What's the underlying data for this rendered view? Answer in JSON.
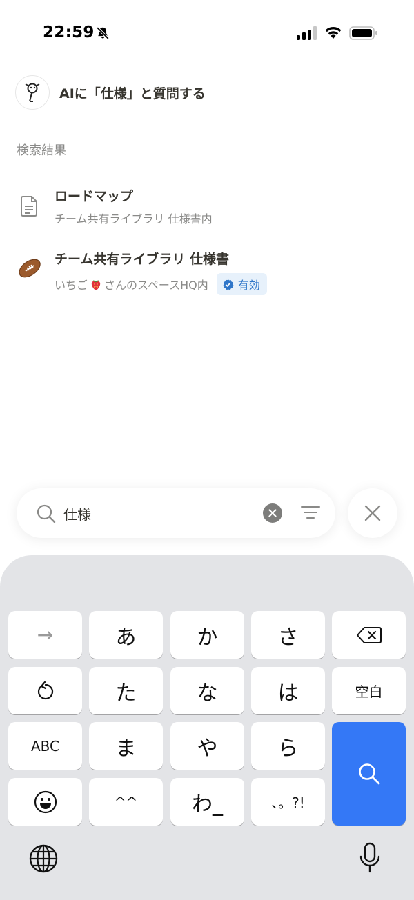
{
  "status_bar": {
    "time": "22:59"
  },
  "ai_prompt": {
    "label": "AIに「仕様」と質問する"
  },
  "section": {
    "title": "検索結果"
  },
  "results": [
    {
      "title": "ロードマップ",
      "subtitle": "チーム共有ライブラリ 仕様書内",
      "icon": "document-icon"
    },
    {
      "title": "チーム共有ライブラリ 仕様書",
      "subtitle_prefix": "いちご",
      "subtitle_suffix": "さんのスペースHQ内",
      "badge": "有効",
      "icon": "football-icon"
    }
  ],
  "search": {
    "value": "仕様"
  },
  "keyboard": {
    "row1": [
      "→",
      "あ",
      "か",
      "さ"
    ],
    "row2": [
      "た",
      "な",
      "は",
      "空白"
    ],
    "row3": [
      "ABC",
      "ま",
      "や",
      "ら"
    ],
    "row4": [
      "^^",
      "わ_",
      "、。?!"
    ]
  },
  "colors": {
    "accent": "#3478f6",
    "badge_text": "#2f76c9",
    "badge_bg": "#e7f1fb"
  }
}
